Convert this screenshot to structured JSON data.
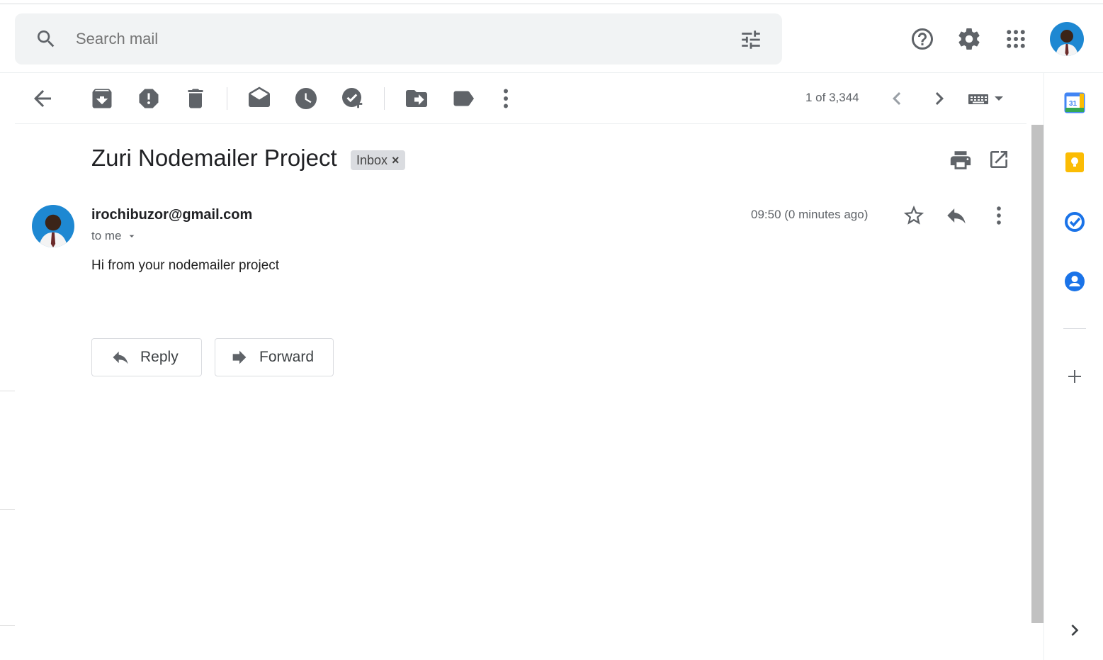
{
  "search": {
    "placeholder": "Search mail"
  },
  "header": {
    "icons": [
      "help-icon",
      "settings-icon",
      "apps-icon",
      "account-avatar"
    ]
  },
  "toolbar": {
    "icons": [
      "back-icon",
      "archive-icon",
      "report-spam-icon",
      "delete-icon",
      "mark-unread-icon",
      "snooze-icon",
      "add-to-tasks-icon",
      "move-to-icon",
      "label-icon",
      "more-icon"
    ],
    "pager": "1 of 3,344"
  },
  "message": {
    "subject": "Zuri Nodemailer Project",
    "label": "Inbox",
    "label_remove": "×",
    "sender": "irochibuzor@gmail.com",
    "recipient": "to me",
    "time": "09:50 (0 minutes ago)",
    "body": "Hi from your nodemailer project"
  },
  "actions": {
    "reply": "Reply",
    "forward": "Forward"
  },
  "side_panel": {
    "apps": [
      "calendar-icon",
      "keep-icon",
      "tasks-icon",
      "contacts-icon"
    ],
    "calendar_day": "31"
  },
  "colors": {
    "calendar_blue": "#4285f4",
    "keep_yellow": "#fbbc04",
    "tasks_blue": "#1a73e8",
    "contacts_blue": "#1a73e8",
    "icon_gray": "#5f6368"
  }
}
